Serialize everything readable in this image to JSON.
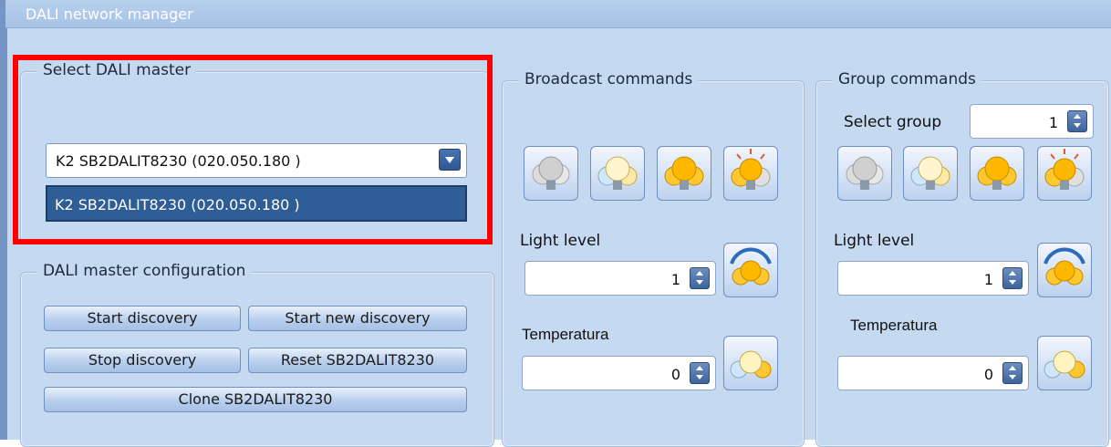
{
  "window": {
    "title": "DALI network manager"
  },
  "select_master": {
    "label": "Select DALI master",
    "selected": "K2 SB2DALIT8230 (020.050.180 )",
    "options": [
      "K2 SB2DALIT8230 (020.050.180 )"
    ]
  },
  "master_config": {
    "label": "DALI master configuration",
    "buttons": {
      "start_discovery": "Start discovery",
      "start_new_discovery": "Start new discovery",
      "stop_discovery": "Stop discovery",
      "reset": "Reset SB2DALIT8230",
      "clone": "Clone SB2DALIT8230"
    }
  },
  "broadcast": {
    "label": "Broadcast commands",
    "light_level_label": "Light level",
    "light_level_value": "1",
    "temperature_label": "Temperatura",
    "temperature_value": "0",
    "icons": [
      "bulbs-off-icon",
      "bulbs-on-icon",
      "bulbs-max-icon",
      "bulbs-scene-icon",
      "light-level-apply-icon",
      "temperature-apply-icon"
    ]
  },
  "group": {
    "label": "Group commands",
    "select_group_label": "Select group",
    "select_group_value": "1",
    "light_level_label": "Light level",
    "light_level_value": "1",
    "temperature_label": "Temperatura",
    "temperature_value": "0",
    "icons": [
      "bulbs-off-icon",
      "bulbs-on-icon",
      "bulbs-max-icon",
      "bulbs-scene-icon",
      "light-level-apply-icon",
      "temperature-apply-icon"
    ]
  },
  "colors": {
    "highlight": "#ff0000",
    "selected_row": "#2f5d95",
    "panel_bg": "#c5d9f1"
  }
}
